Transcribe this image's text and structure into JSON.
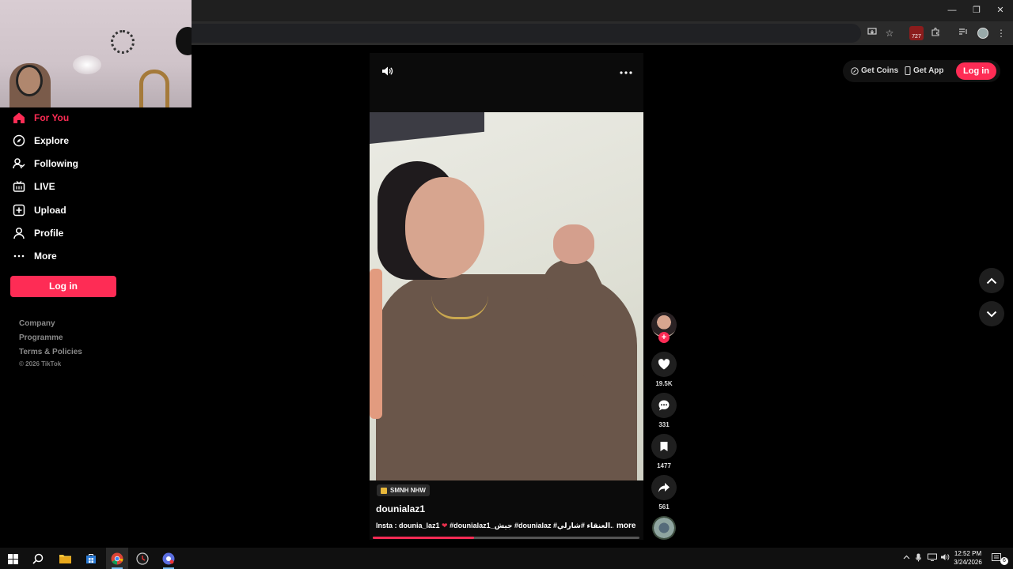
{
  "browser": {
    "window_controls": {
      "minimize": "—",
      "restore": "❐",
      "close": "✕"
    },
    "extension_badge": "727"
  },
  "sidebar": {
    "items": [
      {
        "label": "For You",
        "icon": "home-icon",
        "active": true
      },
      {
        "label": "Explore",
        "icon": "compass-icon",
        "active": false
      },
      {
        "label": "Following",
        "icon": "following-icon",
        "active": false
      },
      {
        "label": "LIVE",
        "icon": "live-tv-icon",
        "active": false
      },
      {
        "label": "Upload",
        "icon": "upload-icon",
        "active": false
      },
      {
        "label": "Profile",
        "icon": "profile-icon",
        "active": false
      },
      {
        "label": "More",
        "icon": "more-icon",
        "active": false
      }
    ],
    "login_label": "Log in",
    "footer_links": [
      "Company",
      "Programme",
      "Terms & Policies"
    ],
    "copyright": "© 2026 TikTok"
  },
  "header": {
    "get_coins": "Get Coins",
    "get_app": "Get App",
    "login": "Log in"
  },
  "video": {
    "tag_label": "SMNH NHW",
    "author": "dounialaz1",
    "caption_prefix": "Insta : dounia_laz1 ",
    "caption_heart": "❤",
    "caption_rest": " #dounialaz1_جيش #dounialaz #العنقاء #شارلي...",
    "more_label": "more",
    "progress_fraction": 0.38
  },
  "actions": {
    "likes": "19.5K",
    "comments": "331",
    "saves": "1477",
    "shares": "561",
    "follow_plus": "+"
  },
  "taskbar": {
    "time": "12:52 PM",
    "date": "3/24/2026",
    "notification_count": "6"
  },
  "colors": {
    "accent": "#fe2c55",
    "background": "#000000",
    "sidebar_footer": "#8a8a8a"
  }
}
